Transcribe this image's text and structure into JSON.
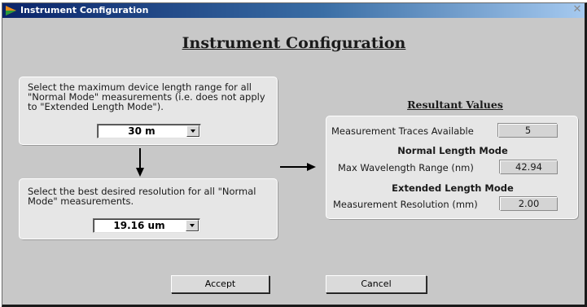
{
  "window": {
    "title": "Instrument Configuration",
    "close_glyph": "✕"
  },
  "page": {
    "title": "Instrument Configuration"
  },
  "length_range": {
    "instruction": "Select the maximum device length range for all \"Normal Mode\" measurements (i.e. does not apply to \"Extended Length Mode\").",
    "selected": "30 m"
  },
  "resolution": {
    "instruction": "Select the best desired resolution for all \"Normal Mode\" measurements.",
    "selected": "19.16 um"
  },
  "results": {
    "header": "Resultant Values",
    "traces_label": "Measurement Traces Available",
    "traces_value": "5",
    "normal_mode_header": "Normal Length Mode",
    "max_wavelength_label": "Max Wavelength Range (nm)",
    "max_wavelength_value": "42.94",
    "extended_mode_header": "Extended Length Mode",
    "resolution_label": "Measurement Resolution (mm)",
    "resolution_value": "2.00"
  },
  "buttons": {
    "accept": "Accept",
    "cancel": "Cancel"
  },
  "icons": {
    "app": "app-icon",
    "close": "close-icon",
    "dropdown": "chevron-down-icon",
    "arrow_down": "arrow-down-icon",
    "arrow_right": "arrow-right-icon"
  },
  "colors": {
    "titlebar_start": "#0a246a",
    "titlebar_end": "#a6caf0",
    "window_bg": "#c8c8c8",
    "panel_bg": "#e6e6e6"
  }
}
